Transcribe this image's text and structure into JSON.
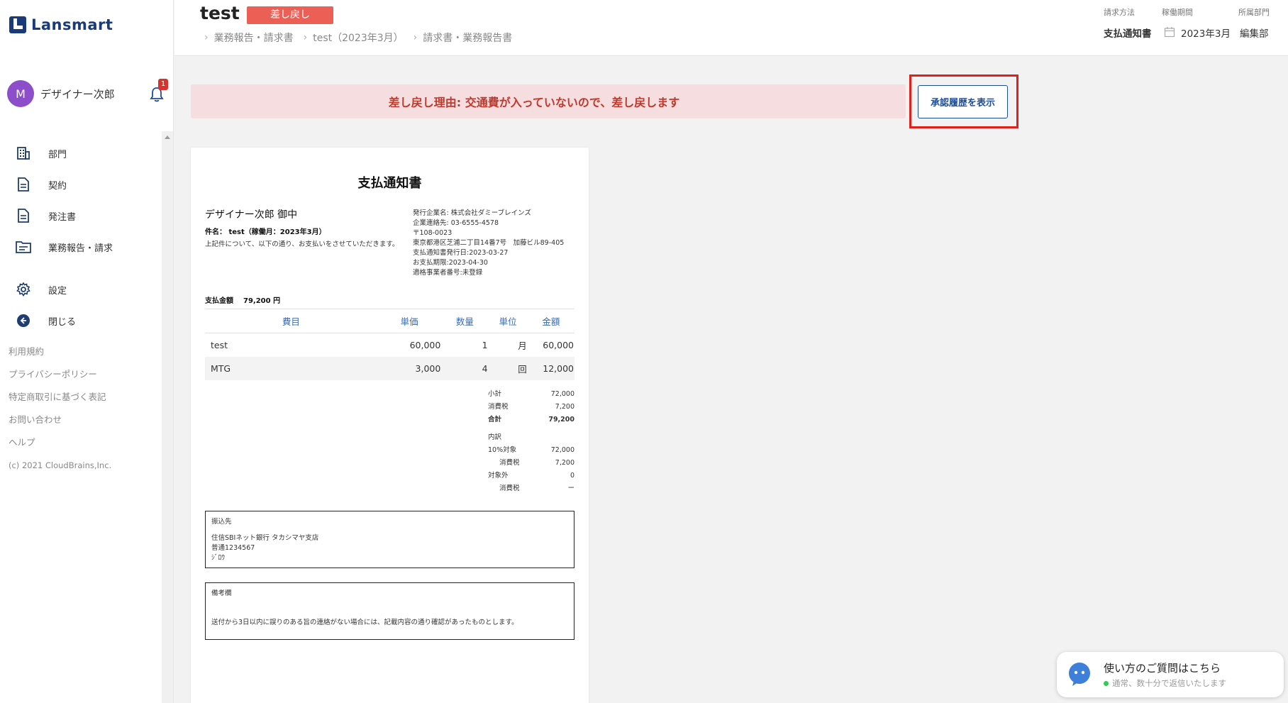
{
  "sidebar": {
    "logo_text": "Lansmart",
    "user_initial": "M",
    "user_name": "デザイナー次郎",
    "notification_count": "1",
    "nav": [
      {
        "label": "部門"
      },
      {
        "label": "契約"
      },
      {
        "label": "発注書"
      },
      {
        "label": "業務報告・請求"
      },
      {
        "label": "設定"
      },
      {
        "label": "閉じる"
      }
    ],
    "links": [
      "利用規約",
      "プライバシーポリシー",
      "特定商取引に基づく表記",
      "お問い合わせ",
      "ヘルプ"
    ],
    "copyright": "(c) 2021 CloudBrains,Inc."
  },
  "header": {
    "title": "test",
    "status": "差し戻し",
    "breadcrumb": [
      "業務報告・請求書",
      "test（2023年3月）",
      "請求書・業務報告書"
    ],
    "meta": {
      "billing_method_label": "請求方法",
      "billing_method_value": "支払通知書",
      "period_label": "稼働期間",
      "period_value": "2023年3月",
      "department_label": "所属部門",
      "department_value": "編集部"
    }
  },
  "alert": {
    "text": "差し戻し理由: 交通費が入っていないので、差し戻します",
    "history_button": "承認履歴を表示"
  },
  "document": {
    "title": "支払通知書",
    "recipient": "デザイナー次郎 御中",
    "subject": "件名： test（稼働月：2023年3月）",
    "intro": "上記件について、以下の通り、お支払いをさせていただきます。",
    "issuer": [
      "発行企業名: 株式会社ダミーブレインズ",
      "企業連絡先: 03-6555-4578",
      "〒108-0023",
      "東京都港区芝浦二丁目14番7号　加藤ビル89-405",
      "支払通知書発行日:2023-03-27",
      "お支払期限:2023-04-30",
      "適格事業者番号:未登録"
    ],
    "amount_label": "支払金額",
    "amount_value": "79,200 円",
    "columns": [
      "費目",
      "単価",
      "数量",
      "単位",
      "金額"
    ],
    "rows": [
      [
        "test",
        "60,000",
        "1",
        "月",
        "60,000"
      ],
      [
        "MTG",
        "3,000",
        "4",
        "回",
        "12,000"
      ]
    ],
    "totals": {
      "subtotal_label": "小計",
      "subtotal": "72,000",
      "tax_label": "消費税",
      "tax": "7,200",
      "total_label": "合計",
      "total": "79,200",
      "breakdown_label": "内訳",
      "taxable_label": "10%対象",
      "taxable": "72,000",
      "taxable_tax_label": "消費税",
      "taxable_tax": "7,200",
      "exempt_label": "対象外",
      "exempt": "0",
      "exempt_tax_label": "消費税",
      "exempt_tax": "ー"
    },
    "bank_title": "振込先",
    "bank_lines": [
      "住信SBIネット銀行 タカシマヤ支店",
      "普通1234567",
      "ｼﾞﾛｳ"
    ],
    "notes_title": "備考欄",
    "notes_text": "送付から3日以内に誤りのある旨の連絡がない場合には、記載内容の通り確認があったものとします。"
  },
  "chat": {
    "title": "使い方のご質問はこちら",
    "subtitle": "通常、数十分で返信いたします"
  }
}
